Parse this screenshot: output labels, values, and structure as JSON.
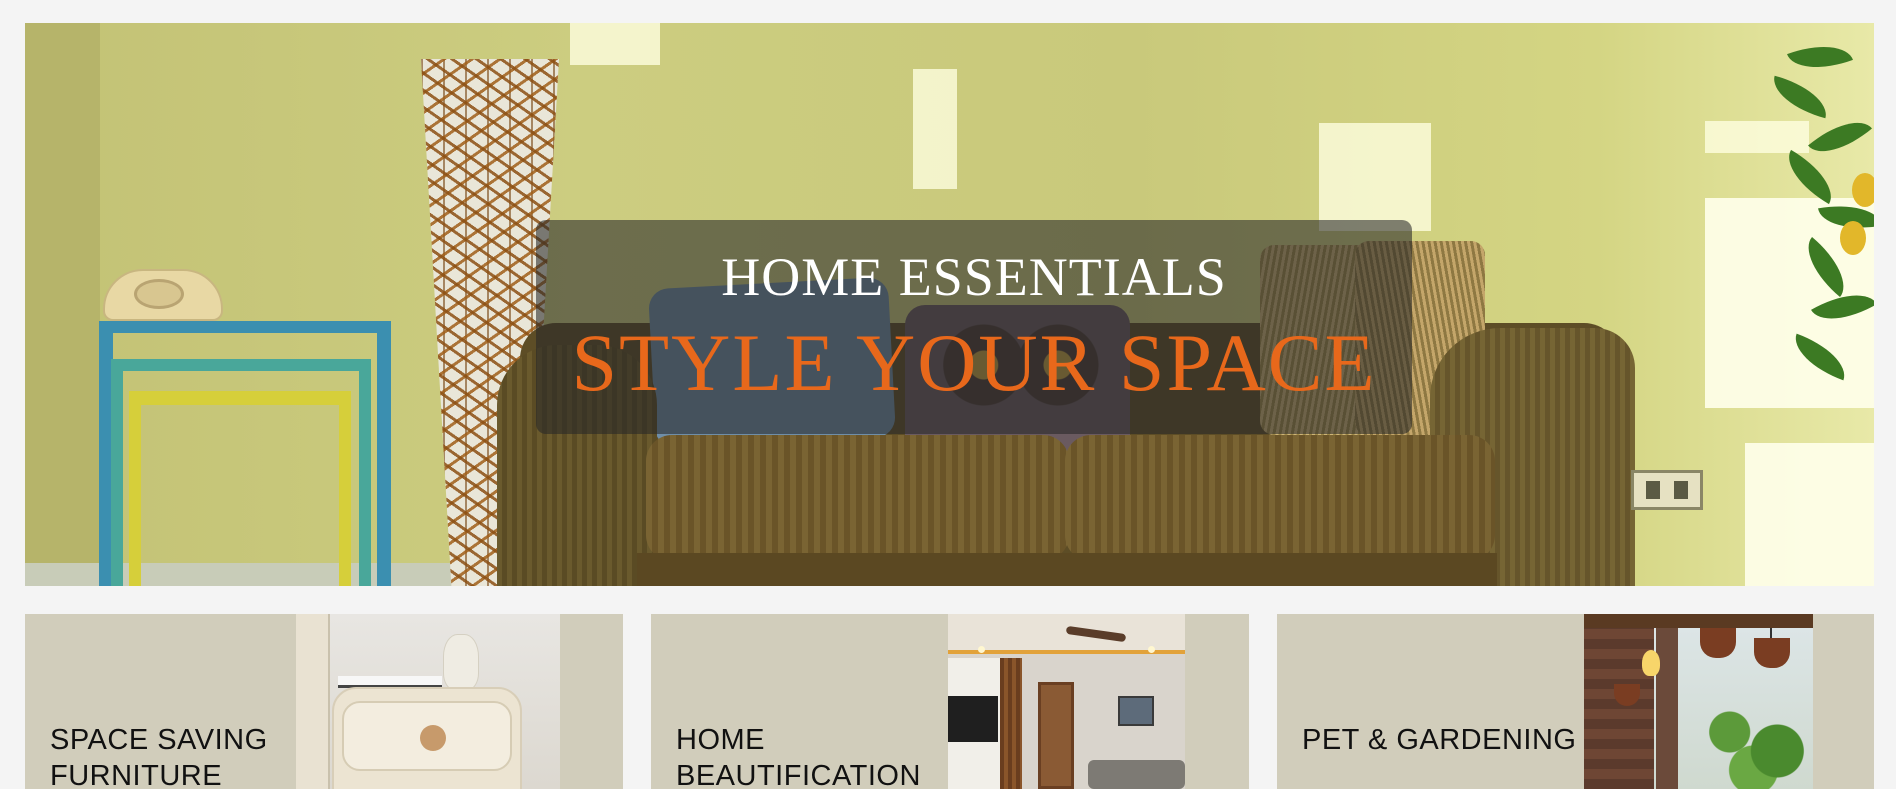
{
  "hero": {
    "subtitle": "HOME ESSENTIALS",
    "title": "STYLE YOUR SPACE",
    "title_color": "#e8681b",
    "overlay_color": "rgba(40,40,40,0.58)"
  },
  "categories": [
    {
      "label": "SPACE SAVING FURNITURE",
      "image": "bedside-cabinet"
    },
    {
      "label": "HOME BEAUTIFICATION",
      "image": "living-room"
    },
    {
      "label": "PET & GARDENING",
      "image": "balcony-garden"
    }
  ],
  "colors": {
    "page_background": "#f4f4f4",
    "card_background": "#d1cdbb",
    "card_text": "#111111"
  }
}
